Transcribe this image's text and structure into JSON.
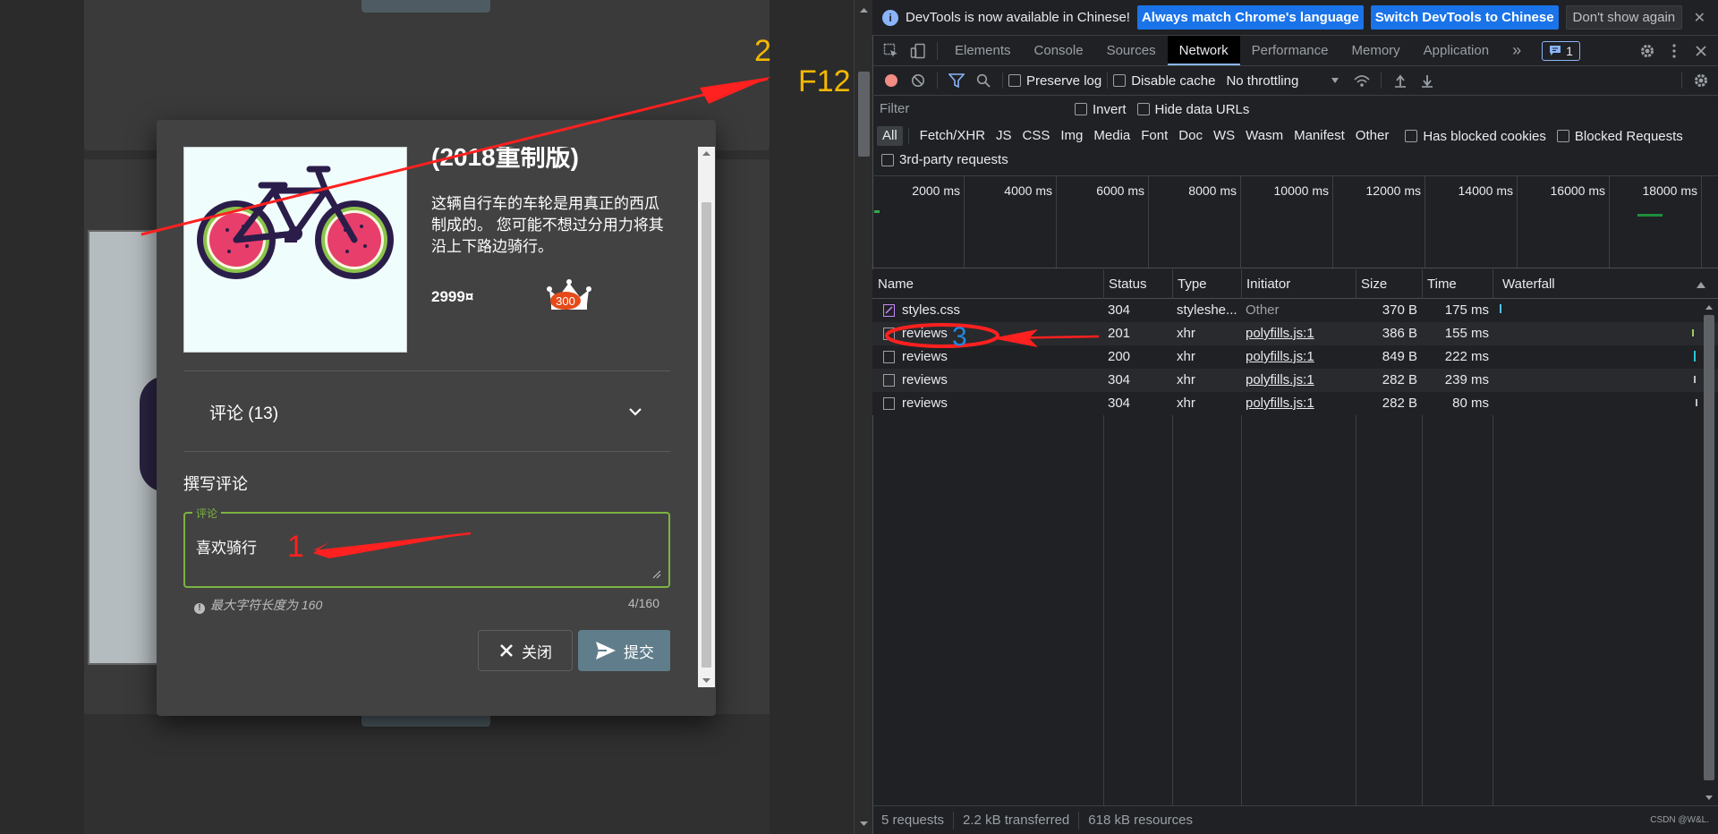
{
  "app": {
    "dialog": {
      "product_title": "(2018重制版)",
      "product_description": "这辆自行车的车轮是用真正的西瓜制成的。 您可能不想过分用力将其沿上下路边骑行。",
      "price": "2999¤",
      "crown_badge": "300",
      "reviews_label": "评论 (13)",
      "write_review_label": "撰写评论",
      "field_label": "评论",
      "field_value": "喜欢骑行",
      "hint": "最大字符长度为 160",
      "hint_icon_glyph": "!",
      "counter": "4/160",
      "close_label": "关闭",
      "submit_label": "提交",
      "colors": {
        "field_border": "#7cb342",
        "submit_bg": "#607d8b"
      }
    }
  },
  "devtools": {
    "infobar": {
      "message": "DevTools is now available in Chinese!",
      "btn_match": "Always match Chrome's language",
      "btn_switch": "Switch DevTools to Chinese",
      "btn_dismiss": "Don't show again",
      "close_glyph": "✕"
    },
    "tabs": [
      "Elements",
      "Console",
      "Sources",
      "Network",
      "Performance",
      "Memory",
      "Application"
    ],
    "active_tab": "Network",
    "more_glyph": "»",
    "issues_count": "1",
    "toolbar": {
      "preserve_log": "Preserve log",
      "disable_cache": "Disable cache",
      "throttling": "No throttling"
    },
    "filter": {
      "placeholder": "Filter",
      "invert": "Invert",
      "hide_data_urls": "Hide data URLs"
    },
    "types": [
      "All",
      "Fetch/XHR",
      "JS",
      "CSS",
      "Img",
      "Media",
      "Font",
      "Doc",
      "WS",
      "Wasm",
      "Manifest",
      "Other"
    ],
    "has_blocked_cookies": "Has blocked cookies",
    "blocked_requests": "Blocked Requests",
    "third_party": "3rd-party requests",
    "overview_ticks": [
      "2000 ms",
      "4000 ms",
      "6000 ms",
      "8000 ms",
      "10000 ms",
      "12000 ms",
      "14000 ms",
      "16000 ms",
      "18000 ms"
    ],
    "columns": [
      "Name",
      "Status",
      "Type",
      "Initiator",
      "Size",
      "Time",
      "Waterfall"
    ],
    "rows": [
      {
        "name": "styles.css",
        "status": "304",
        "type": "styleshe...",
        "initiator": "Other",
        "size": "370 B",
        "time": "175 ms"
      },
      {
        "name": "reviews",
        "status": "201",
        "type": "xhr",
        "initiator": "polyfills.js:1",
        "size": "386 B",
        "time": "155 ms"
      },
      {
        "name": "reviews",
        "status": "200",
        "type": "xhr",
        "initiator": "polyfills.js:1",
        "size": "849 B",
        "time": "222 ms"
      },
      {
        "name": "reviews",
        "status": "304",
        "type": "xhr",
        "initiator": "polyfills.js:1",
        "size": "282 B",
        "time": "239 ms"
      },
      {
        "name": "reviews",
        "status": "304",
        "type": "xhr",
        "initiator": "polyfills.js:1",
        "size": "282 B",
        "time": "80 ms"
      }
    ],
    "status": {
      "requests": "5 requests",
      "transferred": "2.2 kB transferred",
      "resources": "618 kB resources"
    },
    "watermark": "CSDN @W&L."
  },
  "annotations": {
    "step1": "1",
    "step2": "2",
    "step3": "3",
    "f12": "F12",
    "colors": {
      "arrow": "#ff2020",
      "step2": "#f5b800",
      "step3": "#1e88e5"
    }
  }
}
